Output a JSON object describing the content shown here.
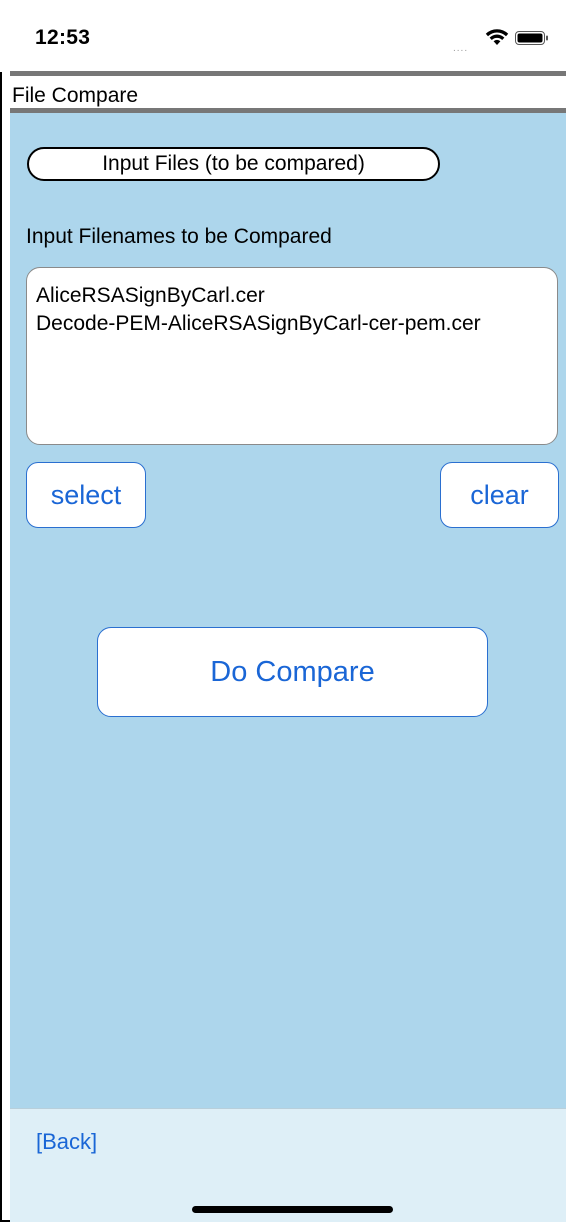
{
  "status_bar": {
    "time": "12:53",
    "signal": "....",
    "wifi_icon": "wifi-icon",
    "battery_icon": "battery-icon"
  },
  "header": {
    "title": "File Compare"
  },
  "main": {
    "section_button_label": "Input Files (to be compared)",
    "filenames_label": "Input Filenames to be Compared",
    "filenames": [
      "AliceRSASignByCarl.cer",
      "Decode-PEM-AliceRSASignByCarl-cer-pem.cer"
    ],
    "select_label": "select",
    "clear_label": "clear",
    "compare_label": "Do Compare"
  },
  "footer": {
    "back_label": "[Back]"
  },
  "colors": {
    "background": "#add6ec",
    "accent": "#1a66d6",
    "footer": "#deeff7",
    "title_border": "#777777"
  }
}
